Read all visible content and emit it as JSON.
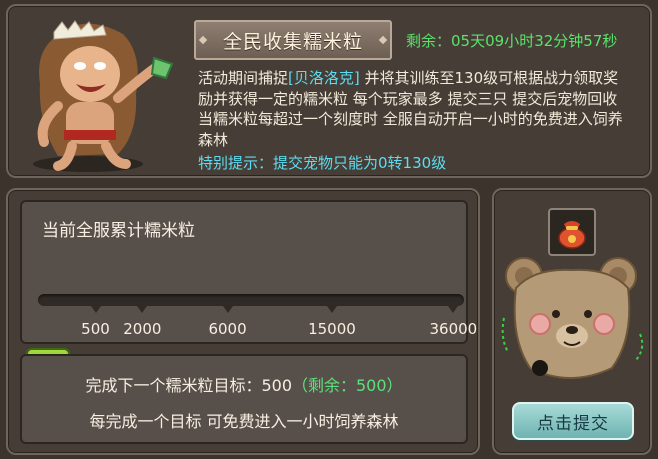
{
  "event": {
    "title": "全民收集糯米粒",
    "timer_label": "剩余：",
    "timer_value": "05天09小时32分钟57秒",
    "desc_before": "活动期间捕捉",
    "desc_pet": "[贝洛洛克]",
    "desc_after": " 并将其训练至130级可根据战力领取奖励并获得一定的糯米粒 每个玩家最多 提交三只 提交后宠物回收 当糯米粒每超过一个刻度时 全服自动开启一小时的免费进入饲养森林",
    "tip_label": "特别提示：",
    "tip_text": "提交宠物只能为0转130级"
  },
  "progress": {
    "title": "当前全服累计糯米粒",
    "current": "0",
    "current_value": 0,
    "max_value": 36000,
    "milestones": [
      500,
      2000,
      6000,
      15000,
      36000
    ],
    "milestone_labels": [
      "500",
      "2000",
      "6000",
      "15000",
      "36000"
    ],
    "bar_color": "#7bc23b"
  },
  "goal": {
    "line1_prefix": "完成下一个糯米粒目标：",
    "target": "500",
    "remaining_text": "（剩余：500）",
    "line2": "每完成一个目标 可免费进入一小时饲养森林"
  },
  "submit": {
    "item_icon": "bag-icon",
    "pet_icon": "bear-pet-icon",
    "button_label": "点击提交"
  }
}
